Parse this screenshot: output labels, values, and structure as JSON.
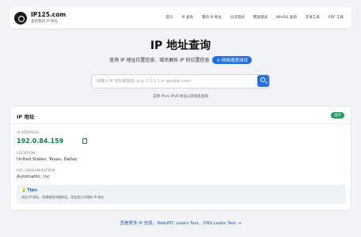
{
  "header": {
    "brand": "IP125.com",
    "tagline": "查询我的 IP 地址",
    "nav": [
      "首页",
      "IP 查询",
      "我的 IP 地址",
      "分流测试",
      "网速测试",
      "WHOIS 查询",
      "开发工具",
      "PDF 工具"
    ]
  },
  "hero": {
    "title": "IP 地址查询",
    "subtitle": "查询 IP 地址位置信息、域名解析 IP 的位置信息",
    "speed_test_button": "⊙ 网络速度测试"
  },
  "search": {
    "placeholder": "请输入 IP 地址或域名 (e.g. 1.1.1.1 or google.com)",
    "hint": "支持 IPv4, IPv6 地址以及域名查询"
  },
  "result": {
    "card_title": "IP 地址",
    "badge": "国内",
    "ip_label": "IP ADDRESS",
    "ip_value": "192.0.84.159",
    "location_label": "LOCATION",
    "location_value": "United States, Texas, Dallas",
    "isp_label": "ISP / ORGANIZATION",
    "isp_value": "Automattic, Inc",
    "tip_title": "Tips:",
    "tip_text": "本机 IP 地址，如果使用代理的话，则会显示代理的 IP 地址"
  },
  "footer": {
    "link_text": "查看更多 IP 信息，WebRTC Leaks Test，DNS Leaks Test →"
  },
  "colors": {
    "accent": "#2473e0",
    "ip_green": "#1a7a4c",
    "badge_green": "#1d9b5c"
  }
}
